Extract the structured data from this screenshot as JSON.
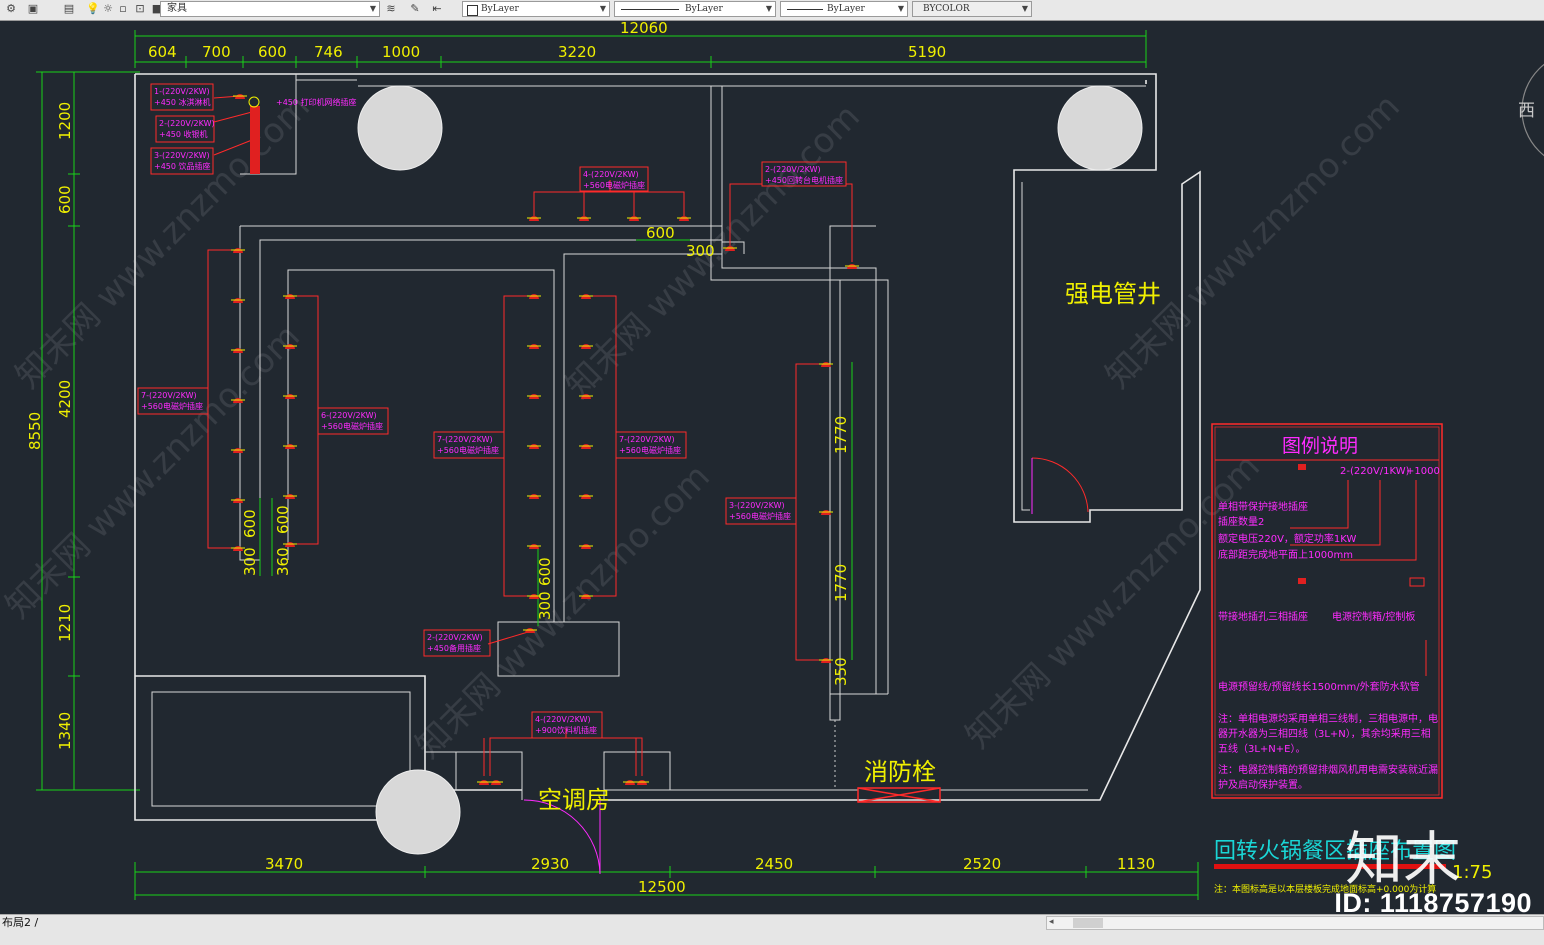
{
  "toolbar": {
    "layer_value": "家具",
    "color_value": "ByLayer",
    "linetype_value": "ByLayer",
    "lineweight_value": "ByLayer",
    "plotstyle_value": "BYCOLOR"
  },
  "status": {
    "layout_tab": "布局2"
  },
  "drawing": {
    "top_total": "12060",
    "top_dims": [
      "604",
      "700",
      "600",
      "746",
      "1000",
      "3220",
      "5190"
    ],
    "bottom_dims": [
      "3470",
      "2930",
      "2450",
      "2520",
      "1130"
    ],
    "bottom_total": "12500",
    "left_total": "8550",
    "left_dims": [
      "1200",
      "600",
      "4200",
      "1210",
      "1340"
    ],
    "inner_dims": {
      "d600a": "600",
      "d300a": "300",
      "d1770a": "1770",
      "d1770b": "1770",
      "d350": "350",
      "d600b": "600",
      "d300b": "300",
      "d600c": "600",
      "d360": "360",
      "d600d": "600",
      "d300c": "300"
    },
    "rooms": {
      "shaft": "强电管井",
      "ac_room": "空调房",
      "hydrant": "消防栓"
    },
    "tags": {
      "t1": [
        "1-(220V/2KW)",
        "+450 冰淇淋机"
      ],
      "t2": [
        "2-(220V/2KW)",
        "+450 收银机"
      ],
      "t3": [
        "3-(220V/2KW)",
        "+450 饮品插座"
      ],
      "t_printer": "+450 打印机网络插座",
      "t_top": [
        "4-(220V/2KW)",
        "+560电磁炉插座"
      ],
      "t_topright": [
        "2-(220V/2KW)",
        "+450回转台电机插座"
      ],
      "t_left7": [
        "7-(220V/2KW)",
        "+560电磁炉插座"
      ],
      "t_left6": [
        "6-(220V/2KW)",
        "+560电磁炉插座"
      ],
      "t_mid7a": [
        "7-(220V/2KW)",
        "+560电磁炉插座"
      ],
      "t_mid7b": [
        "7-(220V/2KW)",
        "+560电磁炉插座"
      ],
      "t_right3": [
        "3-(220V/2KW)",
        "+560电磁炉插座"
      ],
      "t_spare": [
        "2-(220V/2KW)",
        "+450备用插座"
      ],
      "t_bottom": [
        "4-(220V/2KW)",
        "+900饮料机插座"
      ]
    },
    "legend": {
      "title": "图例说明",
      "sample_tag": "2-(220V/1KW)",
      "sample_height": "+1000",
      "l1": "单相带保护接地插座",
      "l2": "插座数量2",
      "l3": "额定电压220V，额定功率1KW",
      "l4": "底部距完成地平面上1000mm",
      "sym2": "带接地插孔三相插座",
      "sym3": "电源控制箱/控制板",
      "sym4": "电源预留线/预留线长1500mm/外套防水软管",
      "note1a": "注：单相电源均采用单相三线制，三相电源中，电",
      "note1b": "器开水器为三相四线（3L+N），其余均采用三相",
      "note1c": "五线（3L+N+E）。",
      "note2a": "注：电器控制箱的预留排烟风机用电需安装就近漏",
      "note2b": "护及启动保护装置。"
    },
    "drawing_title": "回转火锅餐区插座布置图",
    "scale": "1:75",
    "footnote": "注：本图标高是以本层楼板完成地面标高+0.000为计算",
    "watermark": "知末网 www.znzmo.com",
    "compass": "西"
  },
  "brand": "知末",
  "id_label": "ID: 1118757190"
}
